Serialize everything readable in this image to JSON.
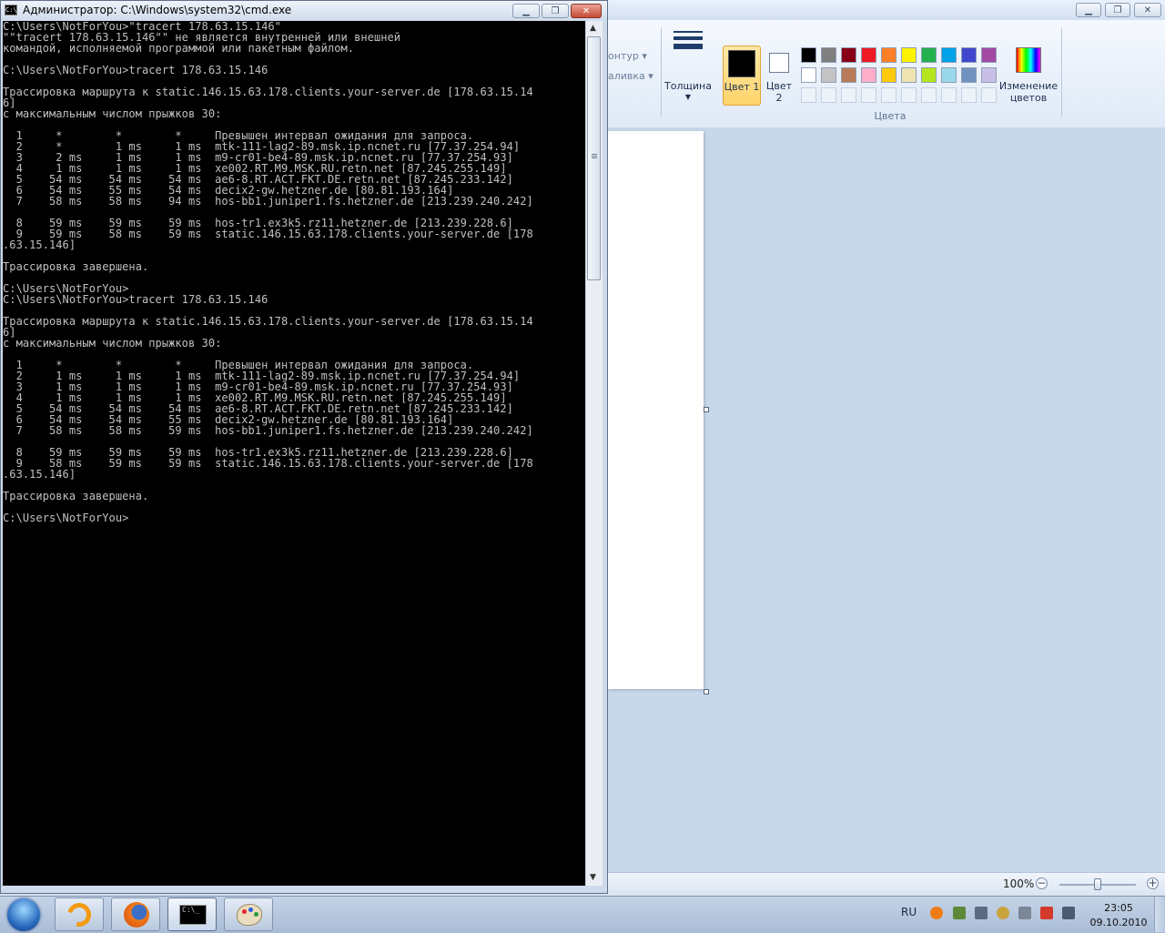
{
  "cmd": {
    "title": "Администратор: C:\\Windows\\system32\\cmd.exe",
    "icon_text": "C:\\",
    "lines": [
      "C:\\Users\\NotForYou>\"tracert 178.63.15.146\"",
      "\"\"tracert 178.63.15.146\"\" не является внутренней или внешней",
      "командой, исполняемой программой или пакетным файлом.",
      "",
      "C:\\Users\\NotForYou>tracert 178.63.15.146",
      "",
      "Трассировка маршрута к static.146.15.63.178.clients.your-server.de [178.63.15.14",
      "6]",
      "с максимальным числом прыжков 30:",
      "",
      "  1     *        *        *     Превышен интервал ожидания для запроса.",
      "  2     *        1 ms     1 ms  mtk-111-lag2-89.msk.ip.ncnet.ru [77.37.254.94]",
      "  3     2 ms     1 ms     1 ms  m9-cr01-be4-89.msk.ip.ncnet.ru [77.37.254.93]",
      "  4     1 ms     1 ms     1 ms  xe002.RT.M9.MSK.RU.retn.net [87.245.255.149]",
      "  5    54 ms    54 ms    54 ms  ae6-8.RT.ACT.FKT.DE.retn.net [87.245.233.142]",
      "  6    54 ms    55 ms    54 ms  decix2-gw.hetzner.de [80.81.193.164]",
      "  7    58 ms    58 ms    94 ms  hos-bb1.juniper1.fs.hetzner.de [213.239.240.242]",
      "",
      "  8    59 ms    59 ms    59 ms  hos-tr1.ex3k5.rz11.hetzner.de [213.239.228.6]",
      "  9    59 ms    58 ms    59 ms  static.146.15.63.178.clients.your-server.de [178",
      ".63.15.146]",
      "",
      "Трассировка завершена.",
      "",
      "C:\\Users\\NotForYou>",
      "C:\\Users\\NotForYou>tracert 178.63.15.146",
      "",
      "Трассировка маршрута к static.146.15.63.178.clients.your-server.de [178.63.15.14",
      "6]",
      "с максимальным числом прыжков 30:",
      "",
      "  1     *        *        *     Превышен интервал ожидания для запроса.",
      "  2     1 ms     1 ms     1 ms  mtk-111-lag2-89.msk.ip.ncnet.ru [77.37.254.94]",
      "  3     1 ms     1 ms     1 ms  m9-cr01-be4-89.msk.ip.ncnet.ru [77.37.254.93]",
      "  4     1 ms     1 ms     1 ms  xe002.RT.M9.MSK.RU.retn.net [87.245.255.149]",
      "  5    54 ms    54 ms    54 ms  ae6-8.RT.ACT.FKT.DE.retn.net [87.245.233.142]",
      "  6    54 ms    54 ms    55 ms  decix2-gw.hetzner.de [80.81.193.164]",
      "  7    58 ms    58 ms    59 ms  hos-bb1.juniper1.fs.hetzner.de [213.239.240.242]",
      "",
      "  8    59 ms    59 ms    59 ms  hos-tr1.ex3k5.rz11.hetzner.de [213.239.228.6]",
      "  9    58 ms    59 ms    59 ms  static.146.15.63.178.clients.your-server.de [178",
      ".63.15.146]",
      "",
      "Трассировка завершена.",
      "",
      "C:\\Users\\NotForYou>"
    ]
  },
  "paint": {
    "contour_label": "онтур",
    "fill_label": "аливка",
    "thickness_label": "Толщина",
    "color1_label": "Цвет 1",
    "color2_label": "Цвет 2",
    "colors_group_label": "Цвета",
    "edit_colors_label": "Изменение цветов",
    "zoom_label": "100%",
    "palette_row1": [
      "#000000",
      "#7f7f7f",
      "#880015",
      "#ed1c24",
      "#ff7f27",
      "#fff200",
      "#22b14c",
      "#00a2e8",
      "#3f48cc",
      "#a349a4"
    ],
    "palette_row2": [
      "#ffffff",
      "#c3c3c3",
      "#b97a57",
      "#ffaec9",
      "#ffc90e",
      "#efe4b0",
      "#b5e61d",
      "#99d9ea",
      "#7092be",
      "#c8bfe7"
    ],
    "color1": "#000000",
    "color2": "#ffffff",
    "zoom_fraction": 0.5
  },
  "taskbar": {
    "language": "RU",
    "time": "23:05",
    "date": "09.10.2010"
  }
}
